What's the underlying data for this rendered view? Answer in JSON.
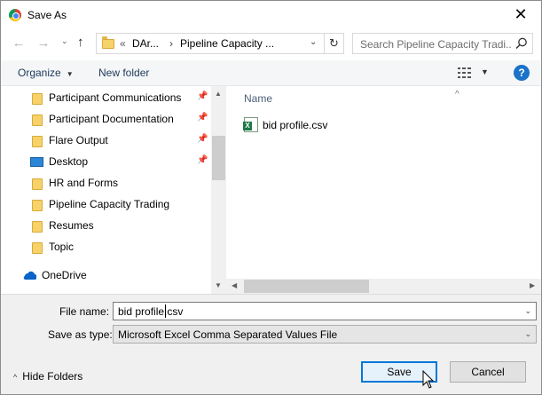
{
  "window": {
    "title": "Save As",
    "close_glyph": "✕"
  },
  "nav": {
    "back_glyph": "←",
    "forward_glyph": "→",
    "dropdown_glyph": "⌄",
    "up_glyph": "↑"
  },
  "address": {
    "overflow": "«",
    "crumbs": [
      "DAr...",
      "›",
      "Pipeline Capacity ..."
    ],
    "separator_first": "›",
    "dropdown_glyph": "⌄",
    "refresh_glyph": "↻"
  },
  "search": {
    "placeholder": "Search Pipeline Capacity Tradi..."
  },
  "toolbar": {
    "organize_label": "Organize",
    "organize_caret": "▼",
    "new_folder_label": "New folder",
    "view_caret": "▼",
    "help_label": "?"
  },
  "sidebar": {
    "items": [
      {
        "label": "Participant Communications",
        "pinned": true,
        "icon": "folder-icon"
      },
      {
        "label": "Participant Documentation",
        "pinned": true,
        "icon": "folder-icon"
      },
      {
        "label": "Flare Output",
        "pinned": true,
        "icon": "folder-icon"
      },
      {
        "label": "Desktop",
        "pinned": true,
        "icon": "desktop-icon"
      },
      {
        "label": "HR and Forms",
        "pinned": false,
        "icon": "folder-icon"
      },
      {
        "label": "Pipeline Capacity Trading",
        "pinned": false,
        "icon": "folder-icon"
      },
      {
        "label": "Resumes",
        "pinned": false,
        "icon": "folder-icon"
      },
      {
        "label": "Topic",
        "pinned": false,
        "icon": "folder-icon"
      },
      {
        "label": "OneDrive",
        "pinned": false,
        "icon": "onedrive-icon"
      }
    ],
    "pin_glyph": "📌",
    "scroll_up": "▲",
    "scroll_down": "▼"
  },
  "file_list": {
    "column_header": "Name",
    "sort_glyph": "^",
    "files": [
      {
        "name": "bid profile.csv",
        "icon": "excel-csv-icon"
      }
    ],
    "scroll_left": "◀",
    "scroll_right": "▶"
  },
  "form": {
    "file_name_label": "File name:",
    "file_name_value": "bid profile.csv",
    "save_as_type_label": "Save as type:",
    "save_as_type_value": "Microsoft Excel Comma Separated Values File",
    "dropdown_glyph": "⌄"
  },
  "footer": {
    "hide_folders_label": "Hide Folders",
    "hide_folders_glyph": "^",
    "save_label": "Save",
    "cancel_label": "Cancel"
  },
  "colors": {
    "accent": "#0078d7",
    "help": "#1a73c9",
    "folder": "#f6d26a",
    "excel": "#1d7a45"
  }
}
